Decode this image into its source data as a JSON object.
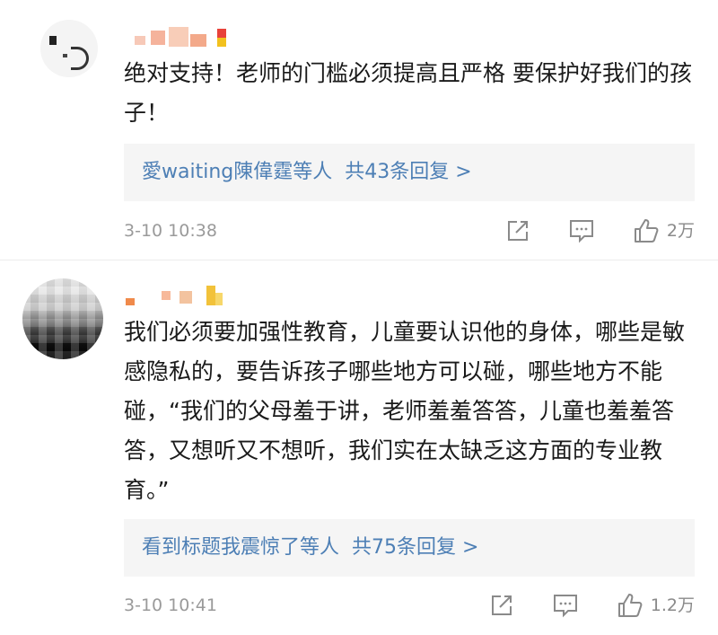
{
  "comments": [
    {
      "text": "绝对支持！老师的门槛必须提高且严格 要保护好我们的孩子！",
      "reply_users": "愛waiting陳偉霆等人",
      "reply_count": "共43条回复 >",
      "time": "3-10 10:38",
      "likes": "2万"
    },
    {
      "text": "我们必须要加强性教育，儿童要认识他的身体，哪些是敏感隐私的，要告诉孩子哪些地方可以碰，哪些地方不能碰，“我们的父母羞于讲，老师羞羞答答，儿童也羞羞答答，又想听又不想听，我们实在太缺乏这方面的专业教育。”",
      "reply_users": "看到标题我震惊了等人",
      "reply_count": "共75条回复 >",
      "time": "3-10 10:41",
      "likes": "1.2万"
    }
  ],
  "icons": {
    "share": "share-icon",
    "comment": "comment-icon",
    "like": "thumbs-up-icon"
  },
  "colors": {
    "link": "#4d7fb5",
    "meta": "#9a9a9a",
    "reply_bg": "#f5f5f5"
  }
}
